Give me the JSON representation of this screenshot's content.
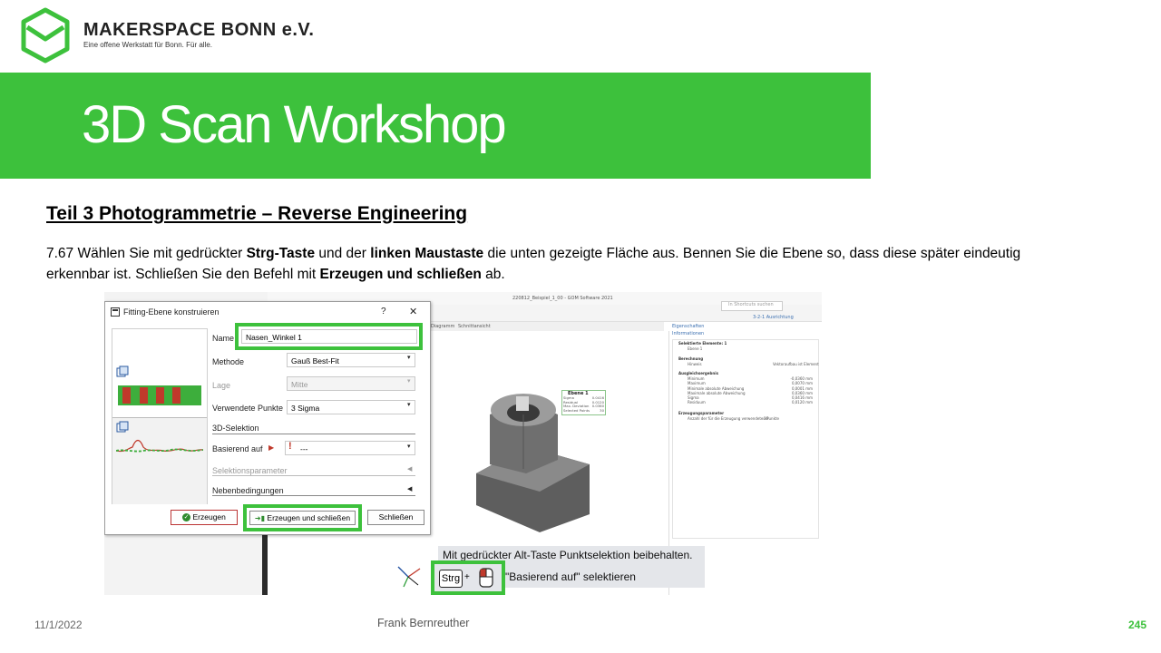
{
  "header": {
    "brand": "MAKERSPACE BONN e.V.",
    "tagline": "Eine offene Werkstatt für Bonn. Für alle.",
    "logo_icon": "hexagon-box-logo-icon",
    "accent_color": "#3dc13c"
  },
  "banner": {
    "title": "3D Scan Workshop"
  },
  "section": {
    "heading": "Teil 3  Photogrammetrie  – Reverse Engineering"
  },
  "instruction": {
    "p1": "7.67 Wählen Sie mit gedrückter ",
    "b1": "Strg-Taste",
    "p2": " und der ",
    "b2": "linken Maustaste",
    "p3": " die unten gezeigte Fläche aus. Bennen Sie die Ebene so, dass diese später eindeutig erkennbar ist. Schließen Sie den Befehl mit ",
    "b3": "Erzeugen und schließen",
    "p4": " ab."
  },
  "app": {
    "window_title": "220812_Beispiel_1_00 - GOM Software 2021",
    "search_placeholder": "In Shortcuts suchen",
    "tabs": [
      "Diagramm",
      "Schnittansicht"
    ],
    "breadcrumb": "3-2-1 Ausrichtung",
    "properties_tab": "Eigenschaften",
    "info_tab": "Informationen",
    "props": {
      "sel_header": "Selektierte Elemente: 1",
      "sel_item": "Ebene 1",
      "calc_header": "Berechnung",
      "hint_label": "Hinweis",
      "hint_value": "Vektoraufbau ist Element",
      "fit_header": "Ausgleichsergebnis",
      "fit_rows": [
        {
          "label": "Minimum",
          "value": "-0,0360 mm"
        },
        {
          "label": "Maximum",
          "value": "0,0070 mm"
        },
        {
          "label": "Minimale absolute Abweichung",
          "value": "0,0001 mm"
        },
        {
          "label": "Maximale absolute Abweichung",
          "value": "0,0360 mm"
        },
        {
          "label": "Sigma",
          "value": "0,0416 mm"
        },
        {
          "label": "Residuum",
          "value": "0,0120 mm"
        }
      ],
      "gen_header": "Erzeugungsparameter",
      "gen_label": "Anzahl der für die Erzeugung verwendeten Punkte",
      "gen_value": "30"
    },
    "callout": {
      "title": "Ebene 1",
      "rows": [
        {
          "label": "Sigma",
          "value": "0.0416"
        },
        {
          "label": "Residual",
          "value": "0.0120"
        },
        {
          "label": "Max. Deviation",
          "value": "0.0360"
        },
        {
          "label": "Selected Points",
          "value": "30"
        }
      ]
    },
    "tooltip": {
      "line1": "Mit gedrückter Alt-Taste Punktselektion beibehalten.",
      "key": "Strg",
      "plus": "+",
      "line2": "\"Basierend auf\" selektieren"
    }
  },
  "dialog": {
    "title": "Fitting-Ebene konstruieren",
    "help": "?",
    "close": "✕",
    "name_label": "Name",
    "name_value": "Nasen_Winkel 1",
    "method_label": "Methode",
    "method_value": "Gauß Best-Fit",
    "position_label": "Lage",
    "position_value": "Mitte",
    "points_label": "Verwendete Punkte",
    "points_value": "3 Sigma",
    "sel3d_header": "3D-Selektion",
    "based_label": "Basierend auf",
    "based_value": "---",
    "selparam_header": "Selektionsparameter",
    "constraints_header": "Nebenbedingungen",
    "btn_create": "Erzeugen",
    "btn_create_close": "Erzeugen und schließen",
    "btn_close": "Schließen"
  },
  "footer": {
    "date": "11/1/2022",
    "author": "Frank Bernreuther",
    "page": "245"
  }
}
